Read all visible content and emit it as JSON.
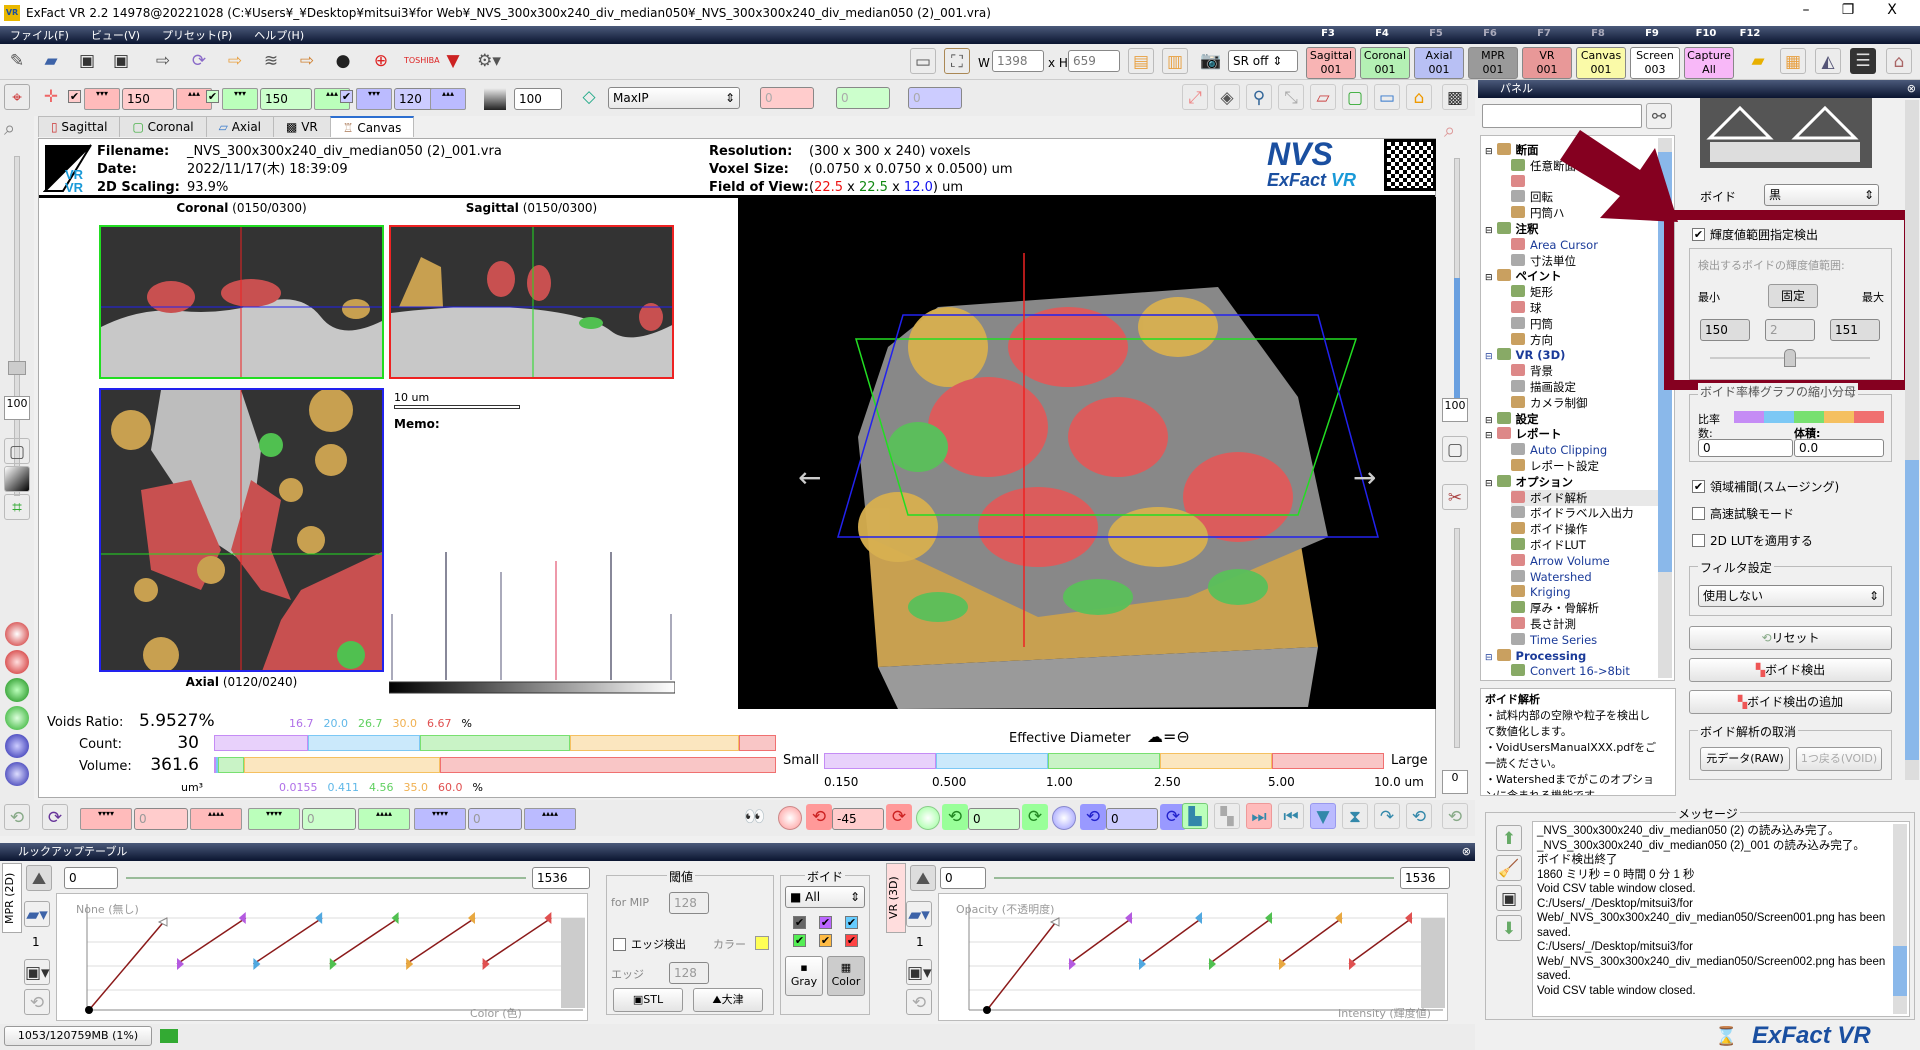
{
  "window": {
    "title": "ExFact VR 2.2 14978@20221028 (C:¥Users¥_¥Desktop¥mitsui3¥for Web¥_NVS_300x300x240_div_median050¥_NVS_300x300x240_div_median050 (2)_001.vra)",
    "minimize": "–",
    "maximize": "❐",
    "close": "X"
  },
  "menu": [
    "ファイル(F)",
    "ビュー(V)",
    "プリセット(P)",
    "ヘルプ(H)"
  ],
  "fkeys": [
    "F3",
    "F4",
    "F5",
    "F6",
    "F7",
    "F8",
    "F9",
    "F10",
    "F12"
  ],
  "toolbar": {
    "w_label": "W",
    "w_value": "1398",
    "h_label": "x H",
    "h_value": "659",
    "sr": "SR off",
    "views": [
      {
        "name": "Sagittal",
        "num": "001",
        "color": "#f8b4b4"
      },
      {
        "name": "Coronal",
        "num": "001",
        "color": "#b4f0b4"
      },
      {
        "name": "Axial",
        "num": "001",
        "color": "#b8c0f4"
      },
      {
        "name": "MPR",
        "num": "001",
        "color": "#9a9a9a"
      },
      {
        "name": "VR",
        "num": "001",
        "color": "#e89898"
      },
      {
        "name": "Canvas",
        "num": "001",
        "color": "#fafaa8"
      },
      {
        "name": "Screen",
        "num": "003",
        "color": "#ffffff"
      },
      {
        "name": "Capture",
        "num": "All",
        "color": "#f8b8f8"
      }
    ]
  },
  "toolbar2": {
    "red": "150",
    "green": "150",
    "blue": "120",
    "gray": "100",
    "mode": "MaxIP",
    "r2": "0",
    "g2": "0",
    "b2": "0"
  },
  "tabs": [
    "Sagittal",
    "Coronal",
    "Axial",
    "VR",
    "Canvas"
  ],
  "left_values": {
    "zoom_top": "100",
    "zoom_right": "100",
    "right_bottom": "0"
  },
  "canvas": {
    "filename_label": "Filename:",
    "filename": "_NVS_300x300x240_div_median050 (2)_001.vra",
    "date_label": "Date:",
    "date": "2022/11/17(木) 18:39:09",
    "scaling_label": "2D Scaling:",
    "scaling": "93.9%",
    "res_label": "Resolution:",
    "res": "(300 x 300 x 240) voxels",
    "voxel_label": "Voxel Size:",
    "voxel": "(0.0750 x 0.0750 x 0.0500) um",
    "fov_label": "Field of View:",
    "fov_x": "22.5",
    "fov_y": "22.5",
    "fov_z": "12.0",
    "fov_unit": "um",
    "logo": "NVS ExFact VR",
    "coronal_title": "Coronal",
    "coronal_idx": "(0150/0300)",
    "sagittal_title": "Sagittal",
    "sagittal_idx": "(0150/0300)",
    "axial_title": "Axial",
    "axial_idx": "(0120/0240)",
    "scale": "10 um",
    "memo": "Memo:"
  },
  "stats": {
    "ratio_label": "Voids Ratio:",
    "ratio": "5.9527%",
    "count_label": "Count:",
    "count": "30",
    "volume_label": "Volume:",
    "volume": "361.6",
    "unit": "um³",
    "colors": [
      "#c58cf5",
      "#7cc8f5",
      "#78e070",
      "#f5c060",
      "#f07070"
    ],
    "count_pct": [
      16.7,
      20.0,
      26.7,
      30.0,
      6.67
    ],
    "count_pct_text": [
      "16.7",
      "20.0",
      "26.7",
      "30.0",
      "6.67",
      "%"
    ],
    "volume_pct": [
      0.0155,
      0.411,
      4.56,
      35.0,
      60.0
    ],
    "volume_pct_text": [
      "0.0155",
      "0.411",
      "4.56",
      "35.0",
      "60.0",
      "%"
    ],
    "eff_label": "Effective Diameter",
    "small": "Small",
    "large": "Large",
    "ticks": [
      "0.150",
      "0.500",
      "1.00",
      "2.50",
      "5.00",
      "10.0 um"
    ]
  },
  "bottom_toolbar": {
    "r": "0",
    "g": "0",
    "b": "0",
    "rot1": "-45",
    "rot2": "0",
    "rot3": "0"
  },
  "panel": {
    "title": "パネル",
    "search": "",
    "tree": [
      {
        "label": "断面",
        "bold": true,
        "level": 0
      },
      {
        "label": "任意断面",
        "level": 1
      },
      {
        "label": "",
        "level": 1
      },
      {
        "label": "回転",
        "level": 1
      },
      {
        "label": "円筒ハ",
        "level": 1
      },
      {
        "label": "注釈",
        "bold": true,
        "level": 0
      },
      {
        "label": "Area Cursor",
        "level": 1,
        "blue": true
      },
      {
        "label": "寸法単位",
        "level": 1
      },
      {
        "label": "ペイント",
        "bold": true,
        "level": 0
      },
      {
        "label": "矩形",
        "level": 1
      },
      {
        "label": "球",
        "level": 1
      },
      {
        "label": "円筒",
        "level": 1
      },
      {
        "label": "方向",
        "level": 1
      },
      {
        "label": "VR (3D)",
        "bold": true,
        "level": 0,
        "blue": true
      },
      {
        "label": "背景",
        "level": 1
      },
      {
        "label": "描画設定",
        "level": 1
      },
      {
        "label": "カメラ制御",
        "level": 1
      },
      {
        "label": "設定",
        "bold": true,
        "level": 0
      },
      {
        "label": "レポート",
        "bold": true,
        "level": 0
      },
      {
        "label": "Auto Clipping",
        "level": 1,
        "blue": true
      },
      {
        "label": "レポート設定",
        "level": 1
      },
      {
        "label": "オプション",
        "bold": true,
        "level": 0
      },
      {
        "label": "ボイド解析",
        "level": 1,
        "selected": true
      },
      {
        "label": "ボイドラベル入出力",
        "level": 1
      },
      {
        "label": "ボイド操作",
        "level": 1
      },
      {
        "label": "ボイドLUT",
        "level": 1
      },
      {
        "label": "Arrow Volume",
        "level": 1,
        "blue": true
      },
      {
        "label": "Watershed",
        "level": 1,
        "blue": true
      },
      {
        "label": "Kriging",
        "level": 1,
        "blue": true
      },
      {
        "label": "厚み・骨解析",
        "level": 1
      },
      {
        "label": "長さ計測",
        "level": 1
      },
      {
        "label": "Time Series",
        "level": 1,
        "blue": true
      },
      {
        "label": "Processing",
        "bold": true,
        "level": 0,
        "blue": true
      },
      {
        "label": "Convert 16->8bit",
        "level": 1,
        "blue": true
      }
    ],
    "desc_title": "ボイド解析",
    "desc_lines": [
      "・試料内部の空隙や粒子を検出して数値化します。",
      "・VoidUsersManualXXX.pdfをご一読ください。",
      "・Watershedまでがこのオプションに含まれる機能です。"
    ],
    "void_label": "ボイド",
    "void_value": "黒",
    "range_check": "輝度値範囲指定検出",
    "range_title": "検出するボイドの輝度値範囲:",
    "min": "最小",
    "fixed": "固定",
    "max": "最大",
    "min_v": "150",
    "mid_v": "2",
    "max_v": "151",
    "slider": 0.5,
    "graph_title": "ボイド率棒グラフの縮小分母",
    "ratio": "比率",
    "count": "数:",
    "volume": "体積:",
    "count_v": "0",
    "volume_v": "0.0",
    "smooth": "領域補間(スムージング)",
    "fast": "高速試験モード",
    "lut2d": "2D LUTを適用する",
    "filter_title": "フィルタ設定",
    "filter": "使用しない",
    "reset": "リセット",
    "detect": "ボイド検出",
    "detect_add": "ボイド検出の追加",
    "cancel_title": "ボイド解析の取消",
    "raw": "元データ(RAW)",
    "undo": "1つ戻る(VOID)",
    "highlight": "#850020"
  },
  "messages": {
    "title": "メッセージ",
    "lines": [
      "_NVS_300x300x240_div_median050 (2) の読み込み完了。",
      "_NVS_300x300x240_div_median050 (2)_001 の読み込み完了。",
      "ボイド検出終了",
      "1860 ミリ秒 = 0 時間 0 分 1 秒",
      "Void CSV table window closed.",
      "C:/Users/_/Desktop/mitsui3/for Web/_NVS_300x300x240_div_median050/Screen001.png has been saved.",
      "C:/Users/_/Desktop/mitsui3/for Web/_NVS_300x300x240_div_median050/Screen002.png has been saved.",
      "Void CSV table window closed."
    ]
  },
  "lut": {
    "title": "ルックアップテーブル",
    "mpr_tab": "MPR (2D)",
    "vr_tab": "VR (3D)",
    "min": "0",
    "max": "1536",
    "preset": "1",
    "mpr_y": "None (無し)",
    "mpr_x": "Color (色)",
    "vr_y": "Opacity (不透明度)",
    "vr_x": "Intensity (輝度値)",
    "thresh_title": "閾値",
    "formip": "for MIP",
    "mip_v": "128",
    "edge_check": "エッジ検出",
    "color_label": "カラー",
    "edge_label": "エッジ",
    "edge_v": "128",
    "stl": "STL",
    "otsu": "大津",
    "void_title": "ボイド",
    "void_sel": "All",
    "gray": "Gray",
    "color": "Color"
  },
  "status": {
    "memory": "1053/120759MB (1%)",
    "brand": "ExFact VR"
  }
}
